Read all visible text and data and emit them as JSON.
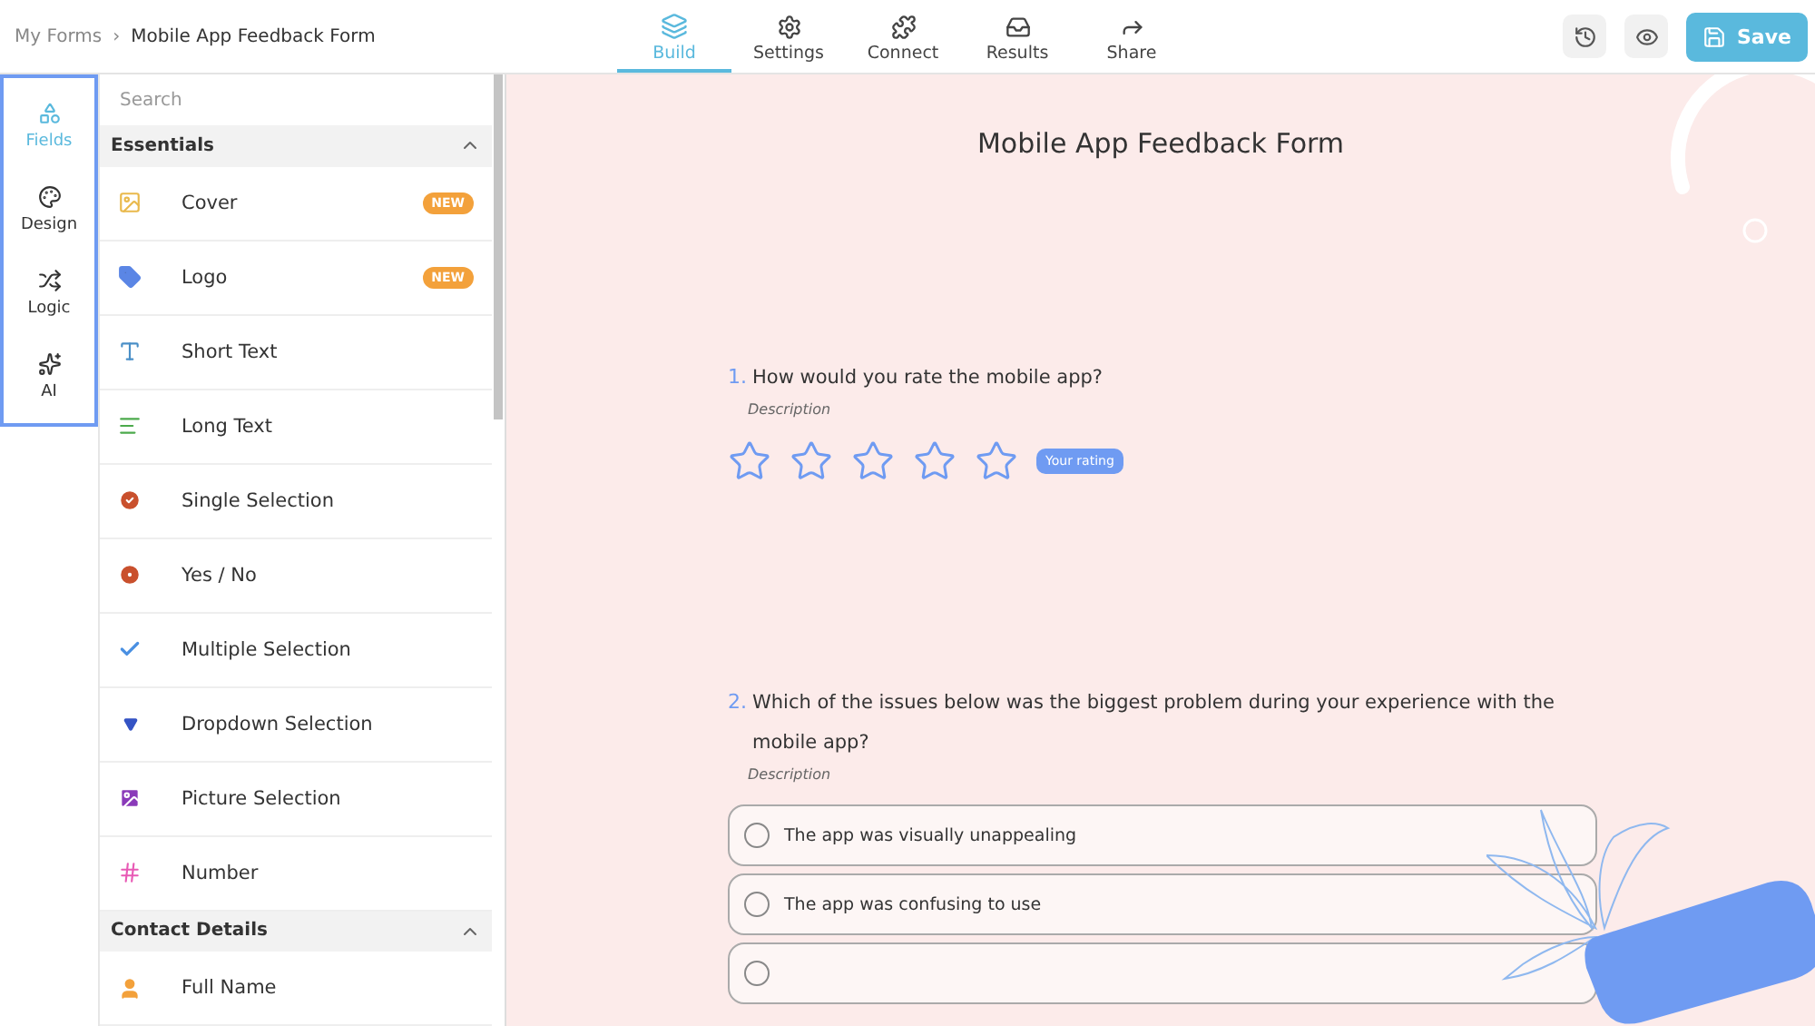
{
  "breadcrumb": {
    "parent": "My Forms",
    "separator": "›",
    "current": "Mobile App Feedback Form"
  },
  "nav_tabs": [
    {
      "label": "Build",
      "kind": "build",
      "selected": true
    },
    {
      "label": "Settings",
      "kind": "settings",
      "selected": false
    },
    {
      "label": "Connect",
      "kind": "connect",
      "selected": false
    },
    {
      "label": "Results",
      "kind": "results",
      "selected": false
    },
    {
      "label": "Share",
      "kind": "share",
      "selected": false
    }
  ],
  "save_button": {
    "label": "Save"
  },
  "rail": [
    {
      "label": "Fields",
      "kind": "fields",
      "selected": true
    },
    {
      "label": "Design",
      "kind": "design",
      "selected": false
    },
    {
      "label": "Logic",
      "kind": "logic",
      "selected": false
    },
    {
      "label": "AI",
      "kind": "ai",
      "selected": false
    }
  ],
  "search": {
    "placeholder": "Search"
  },
  "sections": [
    {
      "title": "Essentials",
      "expanded": true,
      "items": [
        {
          "label": "Cover",
          "kind": "cover",
          "badge": "NEW"
        },
        {
          "label": "Logo",
          "kind": "logo",
          "badge": "NEW"
        },
        {
          "label": "Short Text",
          "kind": "short-text"
        },
        {
          "label": "Long Text",
          "kind": "long-text"
        },
        {
          "label": "Single Selection",
          "kind": "single"
        },
        {
          "label": "Yes / No",
          "kind": "yesno"
        },
        {
          "label": "Multiple Selection",
          "kind": "multiple"
        },
        {
          "label": "Dropdown Selection",
          "kind": "dropdown"
        },
        {
          "label": "Picture Selection",
          "kind": "picture"
        },
        {
          "label": "Number",
          "kind": "number"
        }
      ]
    },
    {
      "title": "Contact Details",
      "expanded": true,
      "items": [
        {
          "label": "Full Name",
          "kind": "name"
        }
      ]
    }
  ],
  "form": {
    "title": "Mobile App Feedback Form",
    "questions": [
      {
        "number": "1.",
        "text": "How would you rate the mobile app?",
        "description": "Description",
        "kind": "rating",
        "stars": 0,
        "rating_label": "Your rating"
      },
      {
        "number": "2.",
        "text": "Which of the issues below was the biggest problem during your experience with the mobile app?",
        "description": "Description",
        "kind": "choice",
        "options": [
          {
            "label": "The app was visually unappealing",
            "selected": false
          },
          {
            "label": "The app was confusing to use",
            "selected": false
          },
          {
            "selected": false
          }
        ]
      }
    ]
  }
}
